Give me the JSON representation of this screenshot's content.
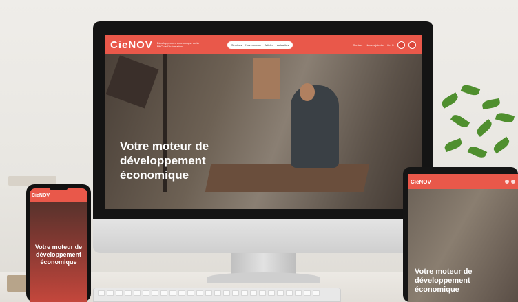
{
  "desktop": {
    "logo": "CieNOV",
    "tagline": "Développement économique de la PNC de l'Automation",
    "nav_items": [
      "Services",
      "Nos bureaux",
      "Articles",
      "Actualités"
    ],
    "nav_right": [
      "Contact",
      "Nous rejoindre",
      "f in ⊙"
    ],
    "hero_title": "Votre moteur de développement économique",
    "accent": "#e9584a"
  },
  "phone": {
    "logo": "CieNOV",
    "hero_title": "Votre moteur de développement économique"
  },
  "tablet": {
    "logo": "CieNOV",
    "hero_title": "Votre moteur de développement économique"
  }
}
